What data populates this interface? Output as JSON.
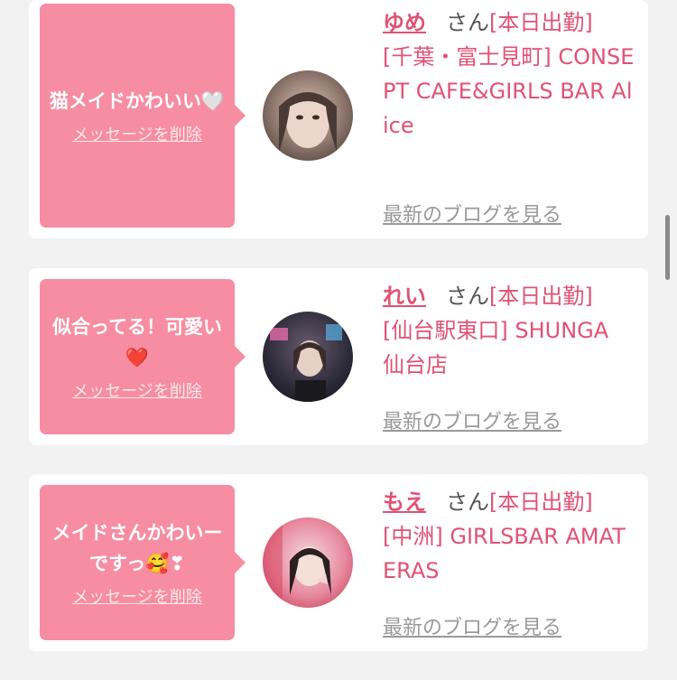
{
  "delete_label": "メッセージを削除",
  "blog_label": "最新のブログを見る",
  "cards": [
    {
      "message": "猫メイドかわいい🤍",
      "name": "ゆめ",
      "san": "さん",
      "status": "[本日出勤]",
      "shop": "[千葉・富士見町] CONSEPT CAFE&GIRLS BAR Alice",
      "avatar_icon": "profile-photo"
    },
    {
      "message": "似合ってる！可愛い❤️",
      "name": "れい",
      "san": "さん",
      "status": "[本日出勤]",
      "shop": "[仙台駅東口] SHUNGA 仙台店",
      "avatar_icon": "profile-photo"
    },
    {
      "message": "メイドさんかわいーですっ🥰❣",
      "name": "もえ",
      "san": "さん",
      "status": "[本日出勤]",
      "shop": "[中洲] GIRLSBAR AMATERAS",
      "avatar_icon": "profile-photo"
    }
  ],
  "colors": {
    "bubble": "#f78da2",
    "accent": "#e05274",
    "background": "#f2f2f2"
  }
}
